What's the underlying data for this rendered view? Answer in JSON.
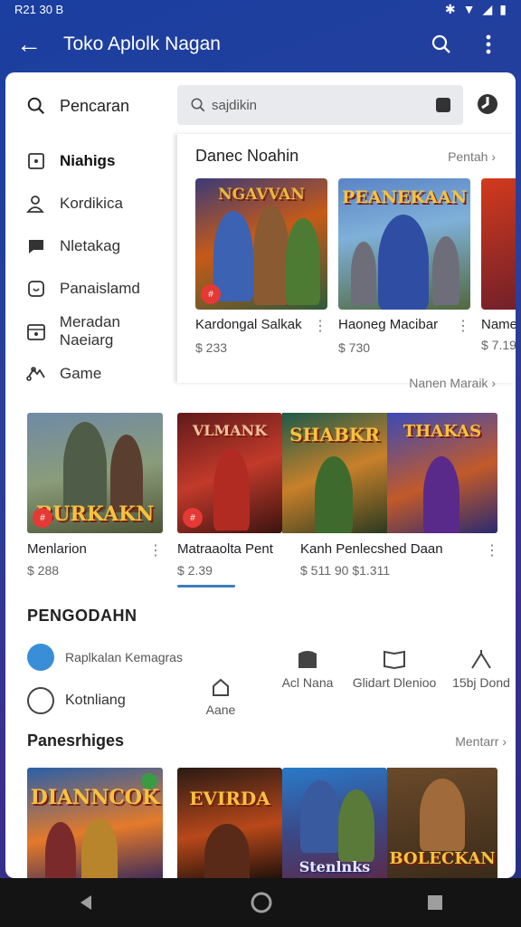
{
  "status_bar": {
    "time": "R21 30 B"
  },
  "app_bar": {
    "title": "Toko Aplolk Nagan"
  },
  "search": {
    "label": "Pencaran",
    "placeholder": "sajdikin"
  },
  "sidebar": {
    "items": [
      {
        "label": "Niahigs",
        "icon": "bookmark-icon"
      },
      {
        "label": "Kordikica",
        "icon": "people-icon"
      },
      {
        "label": "Nletakag",
        "icon": "chat-icon"
      },
      {
        "label": "Panaislamd",
        "icon": "shield-icon"
      },
      {
        "label": "Meradan Naeiarg",
        "icon": "calendar-icon"
      },
      {
        "label": "Game",
        "icon": "controller-icon"
      }
    ]
  },
  "section1": {
    "title": "Danec Noahin",
    "link": "Pentah",
    "cards": [
      {
        "name": "Kardongal Salkak",
        "price": "$ 233",
        "art_title": "NGAVVAN"
      },
      {
        "name": "Haoneg Macibar",
        "price": "$ 730",
        "art_title": "PEANEKAAN"
      },
      {
        "name": "Name",
        "price": "$ 7.19"
      }
    ]
  },
  "section2": {
    "link": "Nanen Maraik",
    "cards": [
      {
        "name": "Menlarion",
        "price": "$ 288",
        "art_title": "BURKAKN"
      },
      {
        "name": "Matraaolta Pent",
        "price": "$ 2.39",
        "art_title": "VLMANK"
      },
      {
        "name": "Kanh Penlecshed Daan",
        "price": "$ 511 90 $1.311",
        "art_title": "SHABKR"
      },
      {
        "art_title": "THAKAS"
      }
    ]
  },
  "pengodaan": {
    "title": "PENGODAHN",
    "items": [
      {
        "label": "Raplkalan Kemagras"
      },
      {
        "label": "Kotnliang"
      }
    ],
    "categories": [
      {
        "label": "Aane",
        "icon": "home-icon"
      },
      {
        "label": "Acl Nana",
        "icon": "store-icon"
      },
      {
        "label": "Glidart Dlenioo",
        "icon": "book-icon"
      },
      {
        "label": "15bj Dond",
        "icon": "tent-icon"
      }
    ]
  },
  "panesrhiges": {
    "title": "Panesrhiges",
    "link": "Mentarr",
    "tiles": [
      {
        "art_title": "DIANNCOK"
      },
      {
        "art_title": "EVIRDA"
      },
      {
        "art_title": "Stenlnks"
      },
      {
        "art_title": "BOLECKAN"
      }
    ]
  },
  "colors": {
    "app_bar_bg": "#1f3fa0",
    "link_underline": "#3b7ec1",
    "install_badge": "#e53935"
  }
}
